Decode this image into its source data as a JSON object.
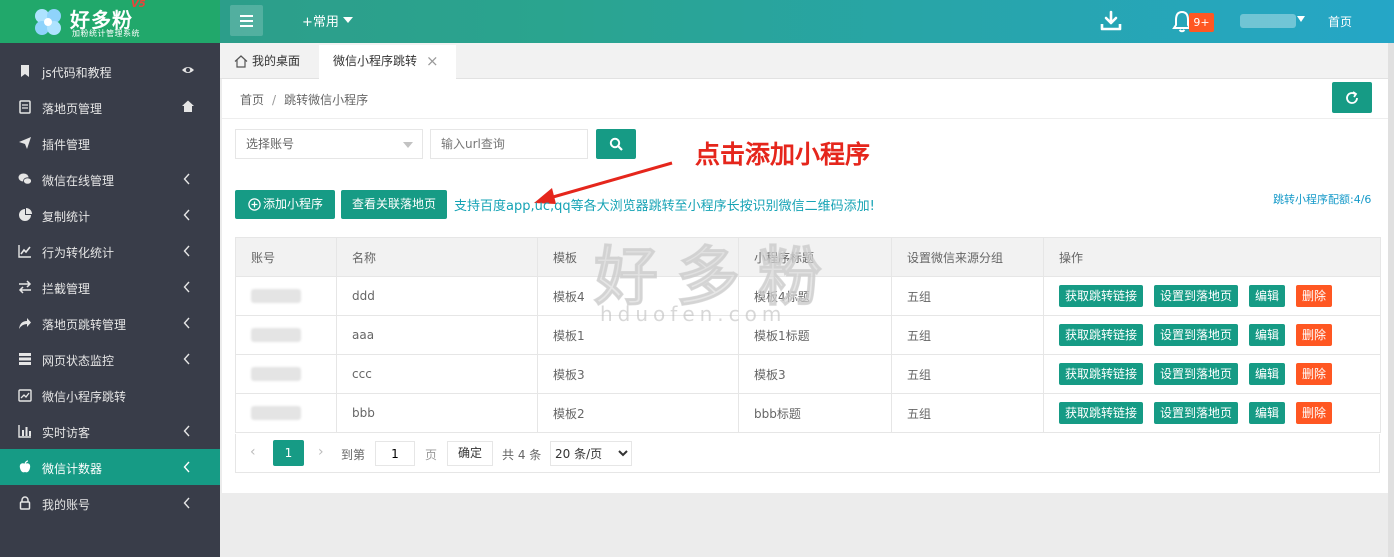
{
  "app": {
    "logo_title": "好多粉",
    "logo_version": "V5",
    "logo_subtitle": "加粉统计管理系统",
    "common_menu": "+常用",
    "notification_count": "9+",
    "home_link": "首页"
  },
  "sidebar": {
    "items": [
      {
        "label": "js代码和教程"
      },
      {
        "label": "落地页管理"
      },
      {
        "label": "插件管理"
      },
      {
        "label": "微信在线管理"
      },
      {
        "label": "复制统计"
      },
      {
        "label": "行为转化统计"
      },
      {
        "label": "拦截管理"
      },
      {
        "label": "落地页跳转管理"
      },
      {
        "label": "网页状态监控"
      },
      {
        "label": "微信小程序跳转"
      },
      {
        "label": "实时访客"
      },
      {
        "label": "微信计数器"
      },
      {
        "label": "我的账号"
      }
    ]
  },
  "tabs": {
    "home": "我的桌面",
    "current": "微信小程序跳转",
    "close": "×"
  },
  "breadcrumb": {
    "home": "首页",
    "sep": "/",
    "current": "跳转微信小程序"
  },
  "filters": {
    "account_placeholder": "选择账号",
    "url_placeholder": "输入url查询"
  },
  "annotation": {
    "text": "点击添加小程序"
  },
  "actions": {
    "add_label": "添加小程序",
    "view_label": "查看关联落地页",
    "support_text": "支持百度app,uc,qq等各大浏览器跳转至小程序长按识别微信二维码添加!",
    "quota_text": "跳转小程序配额:4/6"
  },
  "table": {
    "headers": [
      "账号",
      "名称",
      "模板",
      "小程序标题",
      "设置微信来源分组",
      "操作"
    ],
    "rows": [
      {
        "name": "ddd",
        "template": "模板4",
        "title": "模板4标题",
        "group": "五组"
      },
      {
        "name": "aaa",
        "template": "模板1",
        "title": "模板1标题",
        "group": "五组"
      },
      {
        "name": "ccc",
        "template": "模板3",
        "title": "模板3",
        "group": "五组"
      },
      {
        "name": "bbb",
        "template": "模板2",
        "title": "bbb标题",
        "group": "五组"
      }
    ],
    "op_labels": {
      "get_link": "获取跳转链接",
      "set_landing": "设置到落地页",
      "edit": "编辑",
      "delete": "删除"
    }
  },
  "pagination": {
    "prev": "‹",
    "current_page": "1",
    "next": "›",
    "goto_label": "到第",
    "goto_value": "1",
    "page_label": "页",
    "confirm": "确定",
    "total": "共 4 条",
    "page_size": "20 条/页"
  },
  "watermark": {
    "main": "好多粉",
    "sub": "hduofen.com"
  },
  "colors": {
    "accent": "#169b85",
    "danger": "#ff5722",
    "sidebar_bg": "#393d49",
    "annotation": "#e5261c"
  }
}
